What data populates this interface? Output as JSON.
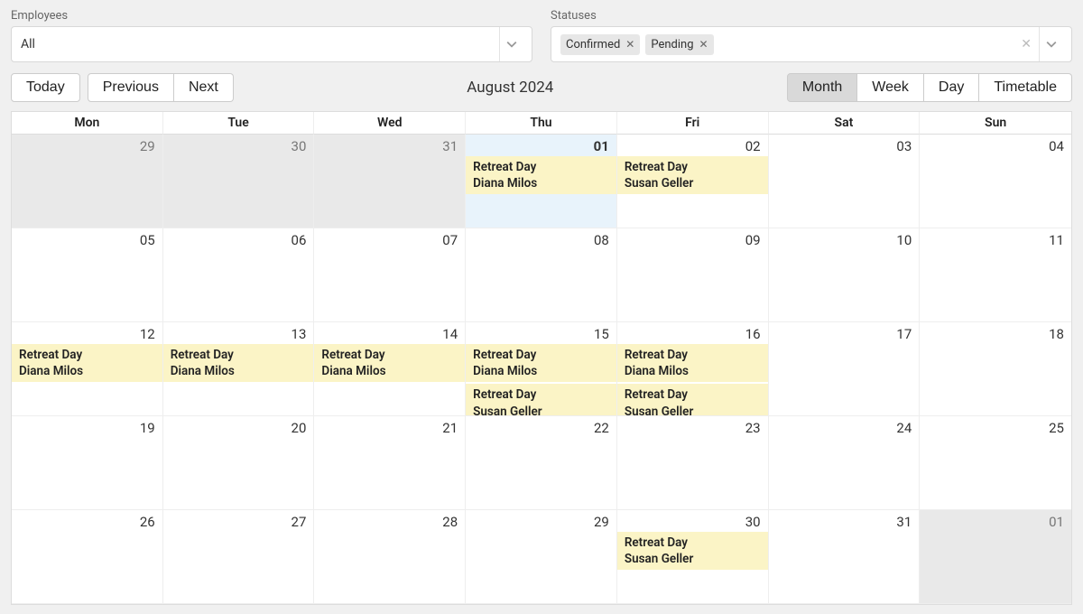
{
  "filters": {
    "employees": {
      "label": "Employees",
      "value": "All"
    },
    "statuses": {
      "label": "Statuses",
      "chips": [
        "Confirmed",
        "Pending"
      ]
    }
  },
  "nav": {
    "today": "Today",
    "previous": "Previous",
    "next": "Next",
    "title": "August 2024"
  },
  "views": {
    "month": "Month",
    "week": "Week",
    "day": "Day",
    "timetable": "Timetable",
    "active": "month"
  },
  "weekdays": [
    "Mon",
    "Tue",
    "Wed",
    "Thu",
    "Fri",
    "Sat",
    "Sun"
  ],
  "cells": [
    {
      "d": "29",
      "other": true
    },
    {
      "d": "30",
      "other": true
    },
    {
      "d": "31",
      "other": true
    },
    {
      "d": "01",
      "today": true,
      "events": [
        {
          "t": "Retreat Day",
          "p": "Diana Milos"
        }
      ]
    },
    {
      "d": "02",
      "events": [
        {
          "t": "Retreat Day",
          "p": "Susan Geller"
        }
      ]
    },
    {
      "d": "03"
    },
    {
      "d": "04"
    },
    {
      "d": "05"
    },
    {
      "d": "06"
    },
    {
      "d": "07"
    },
    {
      "d": "08"
    },
    {
      "d": "09"
    },
    {
      "d": "10"
    },
    {
      "d": "11"
    },
    {
      "d": "12",
      "events": [
        {
          "t": "Retreat Day",
          "p": "Diana Milos"
        }
      ]
    },
    {
      "d": "13",
      "events": [
        {
          "t": "Retreat Day",
          "p": "Diana Milos"
        }
      ]
    },
    {
      "d": "14",
      "highlight": true,
      "events": [
        {
          "t": "Retreat Day",
          "p": "Diana Milos"
        }
      ]
    },
    {
      "d": "15",
      "events": [
        {
          "t": "Retreat Day",
          "p": "Diana Milos"
        },
        {
          "t": "Retreat Day",
          "p": "Susan Geller"
        }
      ]
    },
    {
      "d": "16",
      "events": [
        {
          "t": "Retreat Day",
          "p": "Diana Milos"
        },
        {
          "t": "Retreat Day",
          "p": "Susan Geller"
        }
      ]
    },
    {
      "d": "17"
    },
    {
      "d": "18"
    },
    {
      "d": "19"
    },
    {
      "d": "20"
    },
    {
      "d": "21"
    },
    {
      "d": "22"
    },
    {
      "d": "23"
    },
    {
      "d": "24"
    },
    {
      "d": "25"
    },
    {
      "d": "26"
    },
    {
      "d": "27"
    },
    {
      "d": "28"
    },
    {
      "d": "29"
    },
    {
      "d": "30",
      "events": [
        {
          "t": "Retreat Day",
          "p": "Susan Geller"
        }
      ]
    },
    {
      "d": "31"
    },
    {
      "d": "01",
      "other": true
    }
  ]
}
